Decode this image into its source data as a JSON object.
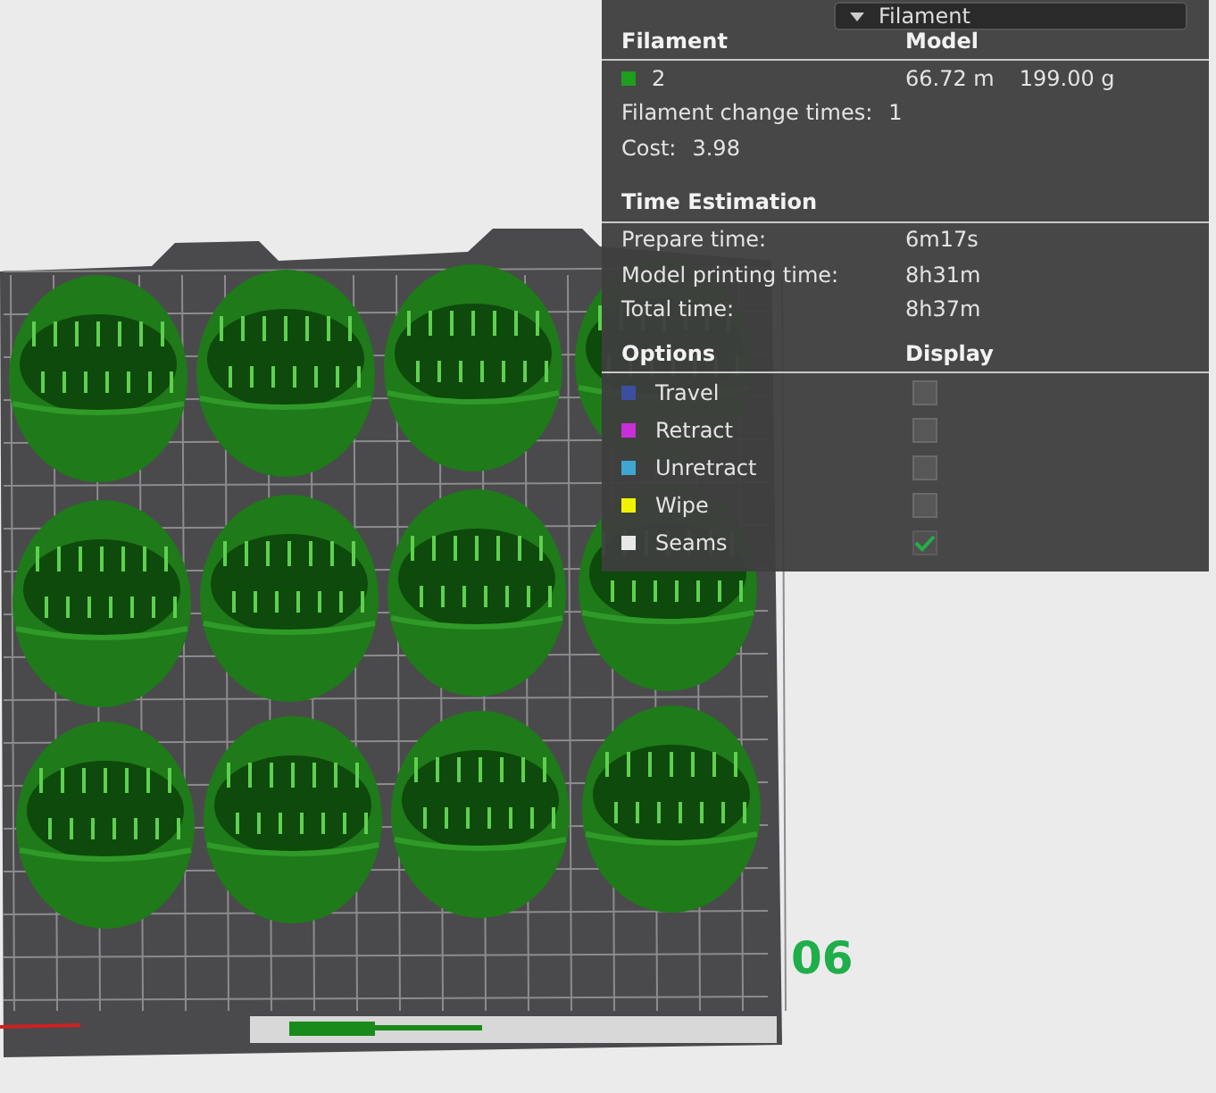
{
  "view_dropdown": {
    "value": "Filament"
  },
  "filament": {
    "headers": [
      "Filament",
      "Model"
    ],
    "items": [
      {
        "name": "2",
        "color": "#1e9e1e",
        "length": "66.72 m",
        "weight": "199.00 g"
      }
    ],
    "change_times": {
      "label": "Filament change times:",
      "value": "1"
    },
    "cost": {
      "label": "Cost:",
      "value": "3.98"
    }
  },
  "time_estimation": {
    "title": "Time Estimation",
    "rows": [
      {
        "label": "Prepare time:",
        "value": "6m17s"
      },
      {
        "label": "Model printing time:",
        "value": "8h31m"
      },
      {
        "label": "Total time:",
        "value": "8h37m"
      }
    ]
  },
  "options": {
    "headers": [
      "Options",
      "Display"
    ],
    "items": [
      {
        "name": "Travel",
        "color": "#3b4ea0",
        "checked": false
      },
      {
        "name": "Retract",
        "color": "#c82fd8",
        "checked": false
      },
      {
        "name": "Unretract",
        "color": "#3fa7cf",
        "checked": false
      },
      {
        "name": "Wipe",
        "color": "#f2f200",
        "checked": false
      },
      {
        "name": "Seams",
        "color": "#e8e8e8",
        "checked": true
      }
    ]
  },
  "plate": {
    "label": "06"
  }
}
